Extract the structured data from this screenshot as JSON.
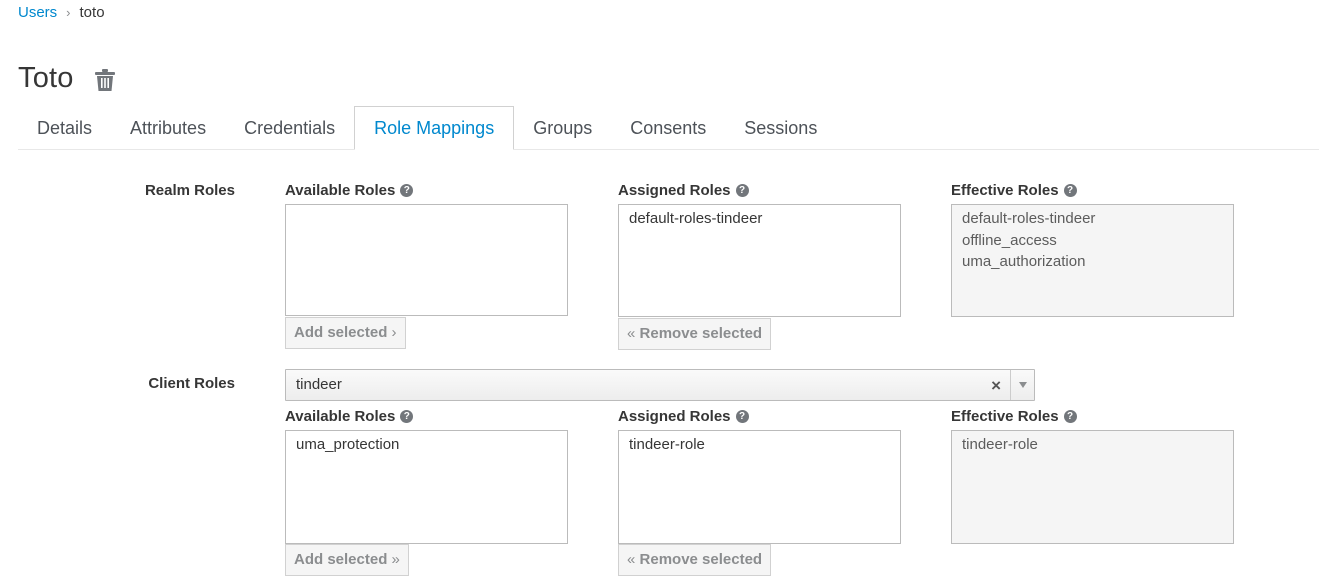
{
  "breadcrumb": {
    "parent": "Users",
    "separator": "›",
    "current": "toto"
  },
  "page": {
    "title": "Toto",
    "delete_icon": "trash-icon"
  },
  "tabs": [
    {
      "label": "Details",
      "active": false
    },
    {
      "label": "Attributes",
      "active": false
    },
    {
      "label": "Credentials",
      "active": false
    },
    {
      "label": "Role Mappings",
      "active": true
    },
    {
      "label": "Groups",
      "active": false
    },
    {
      "label": "Consents",
      "active": false
    },
    {
      "label": "Sessions",
      "active": false
    }
  ],
  "realm_roles": {
    "label": "Realm Roles",
    "available": {
      "header": "Available Roles",
      "items": []
    },
    "assigned": {
      "header": "Assigned Roles",
      "items": [
        "default-roles-tindeer"
      ]
    },
    "effective": {
      "header": "Effective Roles",
      "items": [
        "default-roles-tindeer",
        "offline_access",
        "uma_authorization"
      ]
    },
    "add_button": "Add selected",
    "add_chevron": "›",
    "remove_button": "Remove selected",
    "remove_chevron": "«"
  },
  "client_roles": {
    "label": "Client Roles",
    "client_select": {
      "value": "tindeer",
      "clear": "×"
    },
    "available": {
      "header": "Available Roles",
      "items": [
        "uma_protection"
      ]
    },
    "assigned": {
      "header": "Assigned Roles",
      "items": [
        "tindeer-role"
      ]
    },
    "effective": {
      "header": "Effective Roles",
      "items": [
        "tindeer-role"
      ]
    },
    "add_button": "Add selected",
    "add_chevron": "»",
    "remove_button": "Remove selected",
    "remove_chevron": "«"
  },
  "help_glyph": "?",
  "colors": {
    "link": "#0088ce",
    "text": "#363636",
    "muted": "#8b8d8f"
  }
}
